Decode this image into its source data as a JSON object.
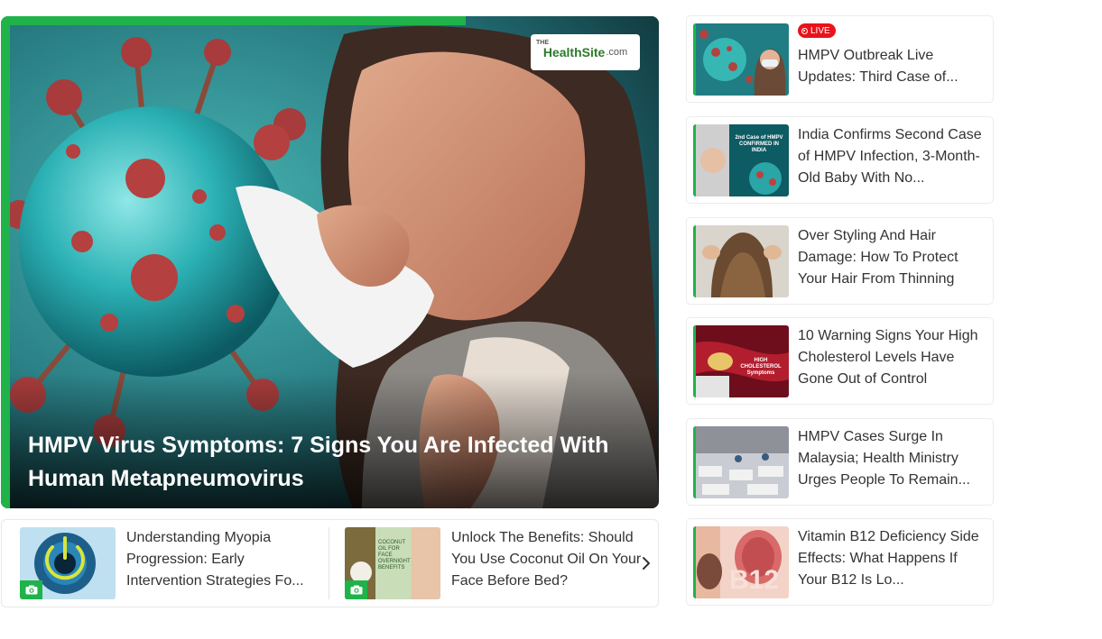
{
  "hero": {
    "logo_top": "THE",
    "logo_brand": "HealthSite",
    "logo_tld": ".com",
    "title": "HMPV Virus Symptoms: 7 Signs You Are Infected With Human Metapneumovirus"
  },
  "carousel": {
    "items": [
      {
        "title": "Understanding Myopia Progression: Early Intervention Strategies Fo...",
        "thumb_icon": "camera-icon"
      },
      {
        "title": "Unlock The Benefits: Should You Use Coconut Oil On Your Face Before Bed?",
        "thumb_icon": "camera-icon",
        "thumb_text": "COCONUT OIL FOR FACE OVERNIGHT BENEFITS"
      }
    ],
    "next_icon": "chevron-right-icon"
  },
  "sidebar": {
    "live_label": "LIVE",
    "items": [
      {
        "title": "HMPV Outbreak Live Updates: Third Case of...",
        "live": true
      },
      {
        "title": "India Confirms Second Case of HMPV Infection, 3-Month-Old Baby With No...",
        "thumb_text": "2nd Case of HMPV CONFIRMED IN INDIA"
      },
      {
        "title": "Over Styling And Hair Damage: How To Protect Your Hair From Thinning"
      },
      {
        "title": "10 Warning Signs Your High Cholesterol Levels Have Gone Out of Control",
        "thumb_text": "HIGH CHOLESTEROL Symptoms"
      },
      {
        "title": "HMPV Cases Surge In Malaysia; Health Ministry Urges People To Remain..."
      },
      {
        "title": "Vitamin B12 Deficiency Side Effects: What Happens If Your B12 Is Lo...",
        "thumb_text": "B12"
      }
    ]
  },
  "colors": {
    "accent": "#1fb34a",
    "live": "#e8131b",
    "text": "#333333"
  }
}
